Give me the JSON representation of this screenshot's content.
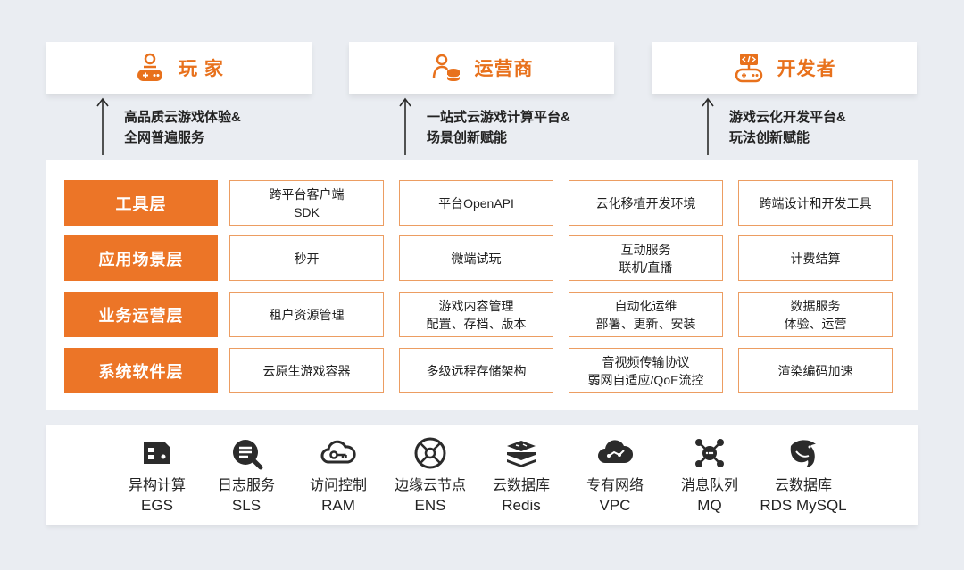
{
  "roles": [
    {
      "label": "玩 家",
      "icon": "gamer-icon",
      "desc": [
        "高品质云游戏体验&",
        "全网普遍服务"
      ]
    },
    {
      "label": "运营商",
      "icon": "operator-icon",
      "desc": [
        "一站式云游戏计算平台&",
        "场景创新赋能"
      ]
    },
    {
      "label": "开发者",
      "icon": "developer-icon",
      "desc": [
        "游戏云化开发平台&",
        "玩法创新赋能"
      ]
    }
  ],
  "layers": [
    {
      "label": "工具层",
      "cells": [
        [
          "跨平台客户端",
          "SDK"
        ],
        [
          "平台OpenAPI"
        ],
        [
          "云化移植开发环境"
        ],
        [
          "跨端设计和开发工具"
        ]
      ]
    },
    {
      "label": "应用场景层",
      "cells": [
        [
          "秒开"
        ],
        [
          "微端试玩"
        ],
        [
          "互动服务",
          "联机/直播"
        ],
        [
          "计费结算"
        ]
      ]
    },
    {
      "label": "业务运营层",
      "cells": [
        [
          "租户资源管理"
        ],
        [
          "游戏内容管理",
          "配置、存档、版本"
        ],
        [
          "自动化运维",
          "部署、更新、安装"
        ],
        [
          "数据服务",
          "体验、运营"
        ]
      ]
    },
    {
      "label": "系统软件层",
      "cells": [
        [
          "云原生游戏容器"
        ],
        [
          "多级远程存储架构"
        ],
        [
          "音视频传输协议",
          "弱网自适应/QoE流控"
        ],
        [
          "渲染编码加速"
        ]
      ]
    }
  ],
  "services": [
    {
      "name": "异构计算",
      "code": "EGS",
      "icon": "egs-chip-icon"
    },
    {
      "name": "日志服务",
      "code": "SLS",
      "icon": "sls-log-icon"
    },
    {
      "name": "访问控制",
      "code": "RAM",
      "icon": "ram-cloud-key-icon"
    },
    {
      "name": "边缘云节点",
      "code": "ENS",
      "icon": "ens-edge-node-icon"
    },
    {
      "name": "云数据库",
      "code": "Redis",
      "icon": "redis-icon"
    },
    {
      "name": "专有网络",
      "code": "VPC",
      "icon": "vpc-cloud-icon"
    },
    {
      "name": "消息队列",
      "code": "MQ",
      "icon": "mq-nodes-icon"
    },
    {
      "name": "云数据库",
      "code": "RDS MySQL",
      "icon": "mysql-dolphin-icon"
    }
  ],
  "colors": {
    "accent": "#ec7527",
    "accent_text": "#e8711c",
    "cell_border": "#ec9d62",
    "icon_dark": "#2b2b2b"
  }
}
